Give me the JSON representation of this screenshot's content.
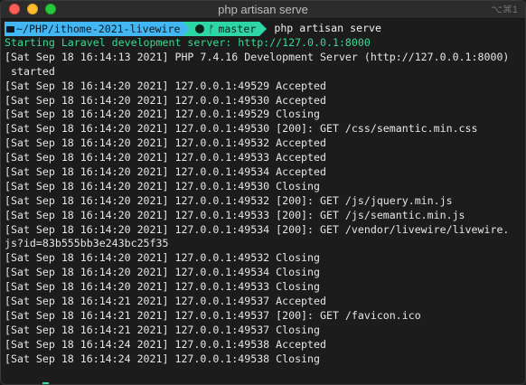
{
  "window": {
    "title": "php artisan serve",
    "shortcut": "⌥⌘1"
  },
  "prompt": {
    "path": "~/PHP/ithome-2021-livewire",
    "git_icon": "octocat-icon",
    "branch_symbol": "ᚠ",
    "branch": "master",
    "command": "php artisan serve"
  },
  "colors": {
    "path_bg": "#42b7f3",
    "git_bg": "#2fd6a5",
    "highlight_text": "#36d993"
  },
  "output": [
    "Starting Laravel development server: http://127.0.0.1:8000",
    "[Sat Sep 18 16:14:13 2021] PHP 7.4.16 Development Server (http://127.0.0.1:8000)",
    " started",
    "[Sat Sep 18 16:14:20 2021] 127.0.0.1:49529 Accepted",
    "[Sat Sep 18 16:14:20 2021] 127.0.0.1:49530 Accepted",
    "[Sat Sep 18 16:14:20 2021] 127.0.0.1:49529 Closing",
    "[Sat Sep 18 16:14:20 2021] 127.0.0.1:49530 [200]: GET /css/semantic.min.css",
    "[Sat Sep 18 16:14:20 2021] 127.0.0.1:49532 Accepted",
    "[Sat Sep 18 16:14:20 2021] 127.0.0.1:49533 Accepted",
    "[Sat Sep 18 16:14:20 2021] 127.0.0.1:49534 Accepted",
    "[Sat Sep 18 16:14:20 2021] 127.0.0.1:49530 Closing",
    "[Sat Sep 18 16:14:20 2021] 127.0.0.1:49532 [200]: GET /js/jquery.min.js",
    "[Sat Sep 18 16:14:20 2021] 127.0.0.1:49533 [200]: GET /js/semantic.min.js",
    "[Sat Sep 18 16:14:20 2021] 127.0.0.1:49534 [200]: GET /vendor/livewire/livewire.",
    "js?id=83b555bb3e243bc25f35",
    "[Sat Sep 18 16:14:20 2021] 127.0.0.1:49532 Closing",
    "[Sat Sep 18 16:14:20 2021] 127.0.0.1:49534 Closing",
    "[Sat Sep 18 16:14:20 2021] 127.0.0.1:49533 Closing",
    "[Sat Sep 18 16:14:21 2021] 127.0.0.1:49537 Accepted",
    "[Sat Sep 18 16:14:21 2021] 127.0.0.1:49537 [200]: GET /favicon.ico",
    "[Sat Sep 18 16:14:21 2021] 127.0.0.1:49537 Closing",
    "[Sat Sep 18 16:14:24 2021] 127.0.0.1:49538 Accepted",
    "[Sat Sep 18 16:14:24 2021] 127.0.0.1:49538 Closing"
  ],
  "output_highlight_index": 0
}
